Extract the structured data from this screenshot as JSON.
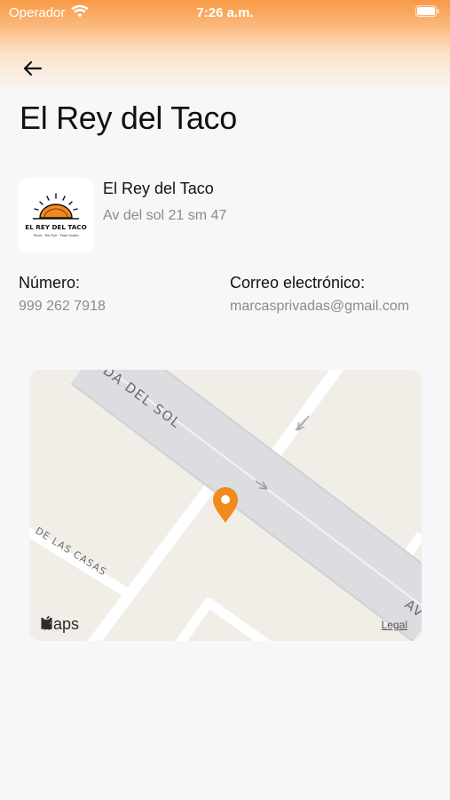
{
  "status_bar": {
    "carrier": "Operador",
    "time": "7:26 a.m."
  },
  "header": {
    "title": "El Rey del Taco"
  },
  "business": {
    "name": "El Rey del Taco",
    "address": "Av del sol 21 sm 47",
    "logo_text": "EL REY DEL TACO",
    "logo_subtext": "Tacos · Rib Eye · Papa Asada"
  },
  "contact": {
    "phone_label": "Número:",
    "phone": "999 262 7918",
    "email_label": "Correo electrónico:",
    "email": "marcasprivadas@gmail.com"
  },
  "map": {
    "street_main": "DA DEL SOL",
    "street_secondary": "DE LAS CASAS",
    "street_corner": "AV",
    "brand": "Maps",
    "legal": "Legal",
    "pin_color": "#f28a1e"
  }
}
